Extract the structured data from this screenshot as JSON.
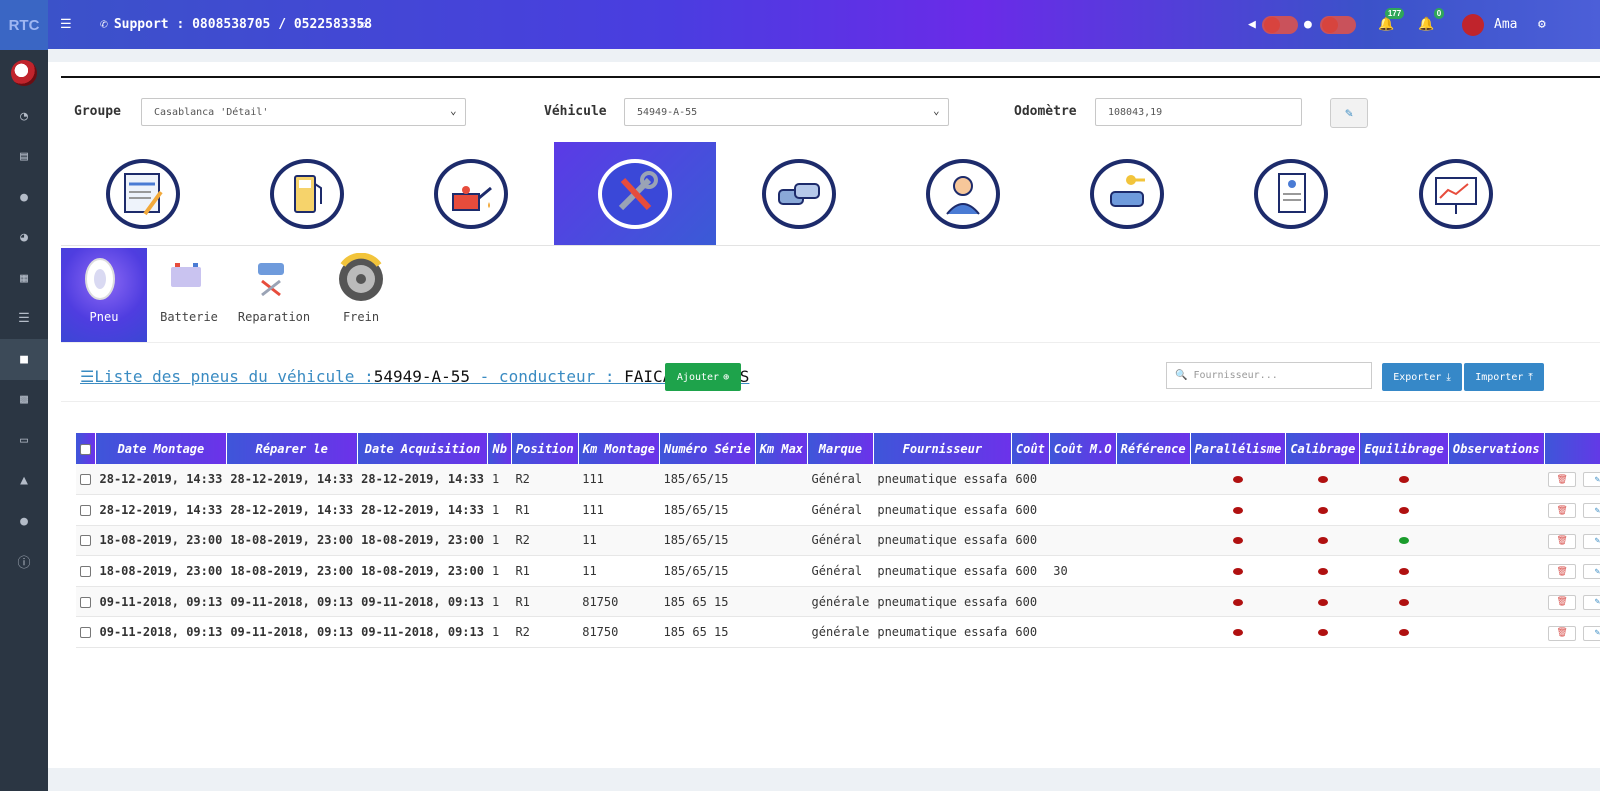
{
  "brand": "RTC",
  "topbar": {
    "support": "Support : 0808538705 / 0522583358",
    "notif_count_1": "177",
    "notif_count_2": "0",
    "user": "Ama"
  },
  "sidebar": {
    "items": [
      "dashboard-icon",
      "server-icon",
      "globe-icon",
      "pie-chart-icon",
      "map-icon",
      "list-icon",
      "car-icon",
      "bar-chart-icon",
      "book-icon",
      "bell-icon",
      "user-icon",
      "info-icon"
    ],
    "active": "car-icon"
  },
  "filters": {
    "groupe_label": "Groupe",
    "groupe_value": "Casablanca 'Détail'",
    "vehicule_label": "Véhicule",
    "vehicule_value": "54949-A-55",
    "odometre_label": "Odomètre",
    "odometre_value": "108043,19"
  },
  "categories": [
    "document",
    "carburant",
    "vidange",
    "entretien",
    "parc",
    "conducteur",
    "location",
    "rapport",
    "presentation"
  ],
  "active_category": "entretien",
  "subtabs": [
    {
      "label": "Pneu",
      "active": true
    },
    {
      "label": "Batterie",
      "active": false
    },
    {
      "label": "Reparation",
      "active": false
    },
    {
      "label": "Frein",
      "active": false
    }
  ],
  "list": {
    "title_prefix": "Liste des pneus du véhicule :",
    "vehicle": "54949-A-55",
    "mid": " - conducteur : ",
    "driver": "FAICAL BELKAS",
    "add_label": "Ajouter",
    "search_placeholder": "Fournisseur...",
    "export_label": "Exporter",
    "import_label": "Importer"
  },
  "colors": {
    "accent": "#3e56d9",
    "accent2": "#6c32ea",
    "add": "#1ea34b",
    "export": "#3688c8",
    "dot_red": "#b01010",
    "dot_green": "#1a9c2c"
  },
  "table": {
    "headers": [
      "Date Montage",
      "Réparer le",
      "Date Acquisition",
      "Nb",
      "Position",
      "Km Montage",
      "Numéro Série",
      "Km Max",
      "Marque",
      "Fournisseur",
      "Coût",
      "Coût M.O",
      "Référence",
      "Parallélisme",
      "Calibrage",
      "Equilibrage",
      "Observations"
    ],
    "rows": [
      {
        "date_montage": "28-12-2019, 14:33",
        "reparer": "28-12-2019, 14:33",
        "acquisition": "28-12-2019, 14:33",
        "nb": "1",
        "position": "R2",
        "km_montage": "111",
        "serie": "185/65/15",
        "km_max": "",
        "marque": "Général",
        "fournisseur": "pneumatique essafa",
        "cout": "600",
        "cout_mo": "",
        "reference": "",
        "parallelisme": "red",
        "calibrage": "red",
        "equilibrage": "red",
        "observations": ""
      },
      {
        "date_montage": "28-12-2019, 14:33",
        "reparer": "28-12-2019, 14:33",
        "acquisition": "28-12-2019, 14:33",
        "nb": "1",
        "position": "R1",
        "km_montage": "111",
        "serie": "185/65/15",
        "km_max": "",
        "marque": "Général",
        "fournisseur": "pneumatique essafa",
        "cout": "600",
        "cout_mo": "",
        "reference": "",
        "parallelisme": "red",
        "calibrage": "red",
        "equilibrage": "red",
        "observations": ""
      },
      {
        "date_montage": "18-08-2019, 23:00",
        "reparer": "18-08-2019, 23:00",
        "acquisition": "18-08-2019, 23:00",
        "nb": "1",
        "position": "R2",
        "km_montage": "11",
        "serie": "185/65/15",
        "km_max": "",
        "marque": "Général",
        "fournisseur": "pneumatique essafa",
        "cout": "600",
        "cout_mo": "",
        "reference": "",
        "parallelisme": "red",
        "calibrage": "red",
        "equilibrage": "green",
        "observations": ""
      },
      {
        "date_montage": "18-08-2019, 23:00",
        "reparer": "18-08-2019, 23:00",
        "acquisition": "18-08-2019, 23:00",
        "nb": "1",
        "position": "R1",
        "km_montage": "11",
        "serie": "185/65/15",
        "km_max": "",
        "marque": "Général",
        "fournisseur": "pneumatique essafa",
        "cout": "600",
        "cout_mo": "30",
        "reference": "",
        "parallelisme": "red",
        "calibrage": "red",
        "equilibrage": "red",
        "observations": ""
      },
      {
        "date_montage": "09-11-2018, 09:13",
        "reparer": "09-11-2018, 09:13",
        "acquisition": "09-11-2018, 09:13",
        "nb": "1",
        "position": "R1",
        "km_montage": "81750",
        "serie": "185 65 15",
        "km_max": "",
        "marque": "générale",
        "fournisseur": "pneumatique essafa",
        "cout": "600",
        "cout_mo": "",
        "reference": "",
        "parallelisme": "red",
        "calibrage": "red",
        "equilibrage": "red",
        "observations": ""
      },
      {
        "date_montage": "09-11-2018, 09:13",
        "reparer": "09-11-2018, 09:13",
        "acquisition": "09-11-2018, 09:13",
        "nb": "1",
        "position": "R2",
        "km_montage": "81750",
        "serie": "185 65 15",
        "km_max": "",
        "marque": "générale",
        "fournisseur": "pneumatique essafa",
        "cout": "600",
        "cout_mo": "",
        "reference": "",
        "parallelisme": "red",
        "calibrage": "red",
        "equilibrage": "red",
        "observations": ""
      }
    ]
  }
}
